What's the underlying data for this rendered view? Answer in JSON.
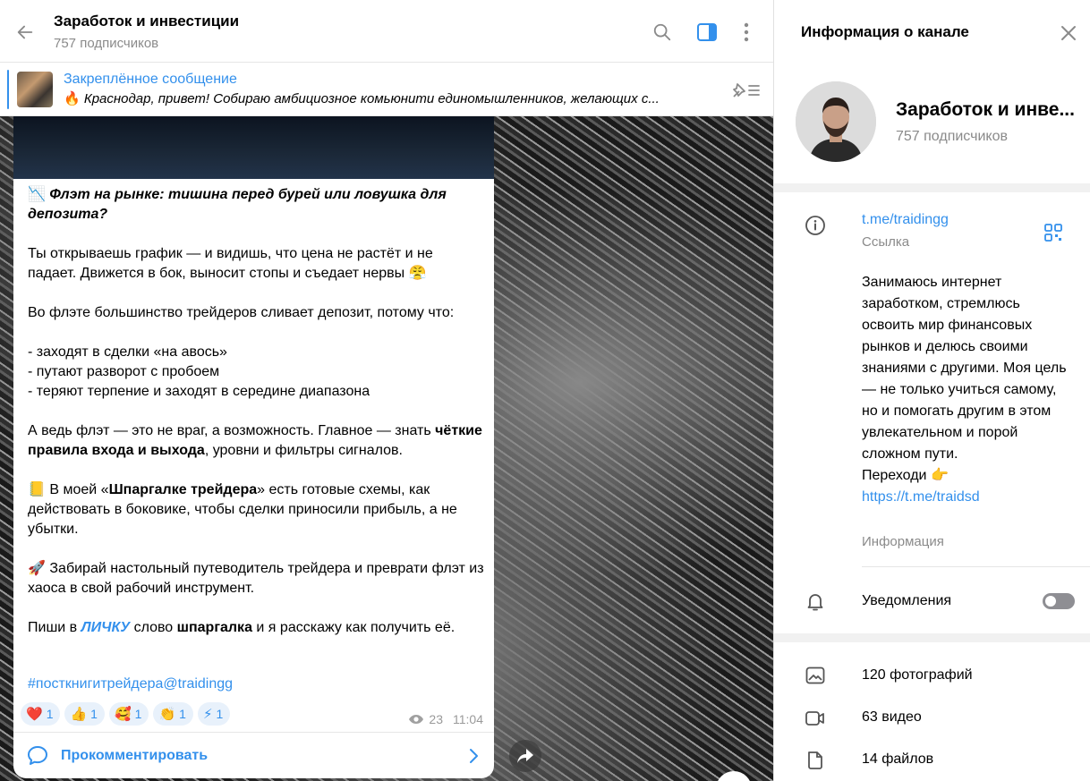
{
  "header": {
    "title": "Заработок и инвестиции",
    "subtitle": "757 подписчиков"
  },
  "pinned": {
    "title": "Закреплённое сообщение",
    "emoji": "🔥",
    "text": "Краснодар, привет! Собираю амбициозное комьюнити единомышленников, желающих с..."
  },
  "post": {
    "heading_emoji": "📉",
    "heading": "Флэт на рынке: тишина перед бурей или ловушка для депозита?",
    "p1": "Ты открываешь график — и видишь, что цена не растёт и не падает. Движется в бок, выносит стопы и съедает нервы",
    "p1_emoji": "😤",
    "p2": "Во флэте большинство трейдеров сливает депозит, потому что:",
    "list": [
      "- заходят в сделки «на авось»",
      "- путают разворот с пробоем",
      "- теряют терпение и заходят в середине диапазона"
    ],
    "p3_a": "А ведь флэт — это не враг, а возможность. Главное — знать",
    "p3_bold": "чёткие правила входа и выхода",
    "p3_b": ", уровни и фильтры сигналов.",
    "p4_emoji": "📒",
    "p4_a": "В моей «",
    "p4_bold": "Шпаргалке трейдера",
    "p4_b": "» есть готовые схемы, как действовать в боковике, чтобы сделки приносили прибыль, а не убытки.",
    "p5_emoji": "🚀",
    "p5": "Забирай настольный путеводитель трейдера и преврати флэт из хаоса в свой рабочий инструмент.",
    "p6_a": "Пиши в",
    "p6_link": "ЛИЧКУ",
    "p6_b": "слово",
    "p6_bold": "шпаргалка",
    "p6_c": "и я расскажу как получить её.",
    "hashtag": "#посткнигитрейдера@traidingg",
    "reactions": [
      {
        "emoji": "❤️",
        "count": "1"
      },
      {
        "emoji": "👍",
        "count": "1"
      },
      {
        "emoji": "🥰",
        "count": "1"
      },
      {
        "emoji": "👏",
        "count": "1"
      },
      {
        "emoji": "⚡",
        "count": "1"
      }
    ],
    "views": "23",
    "time": "11:04",
    "comment_label": "Прокомментировать"
  },
  "info": {
    "title": "Информация о канале",
    "name": "Заработок и инве...",
    "subs": "757 подписчиков",
    "link": "t.me/traidingg",
    "link_label": "Ссылка",
    "about": "Занимаюсь интернет заработком, стремлюсь освоить мир финансовых рынков и делюсь своими знаниями с другими. Моя цель — не только учиться самому, но и помогать другим в этом увлекательном и порой сложном пути.",
    "about_go": "Переходи",
    "about_go_emoji": "👉",
    "about_link": "https://t.me/traidsd",
    "about_label": "Информация",
    "notifications": "Уведомления",
    "notifications_on": false,
    "photos": "120 фотографий",
    "videos": "63 видео",
    "files": "14 файлов"
  },
  "colors": {
    "accent": "#3390ec",
    "muted": "#8a8a8a"
  }
}
